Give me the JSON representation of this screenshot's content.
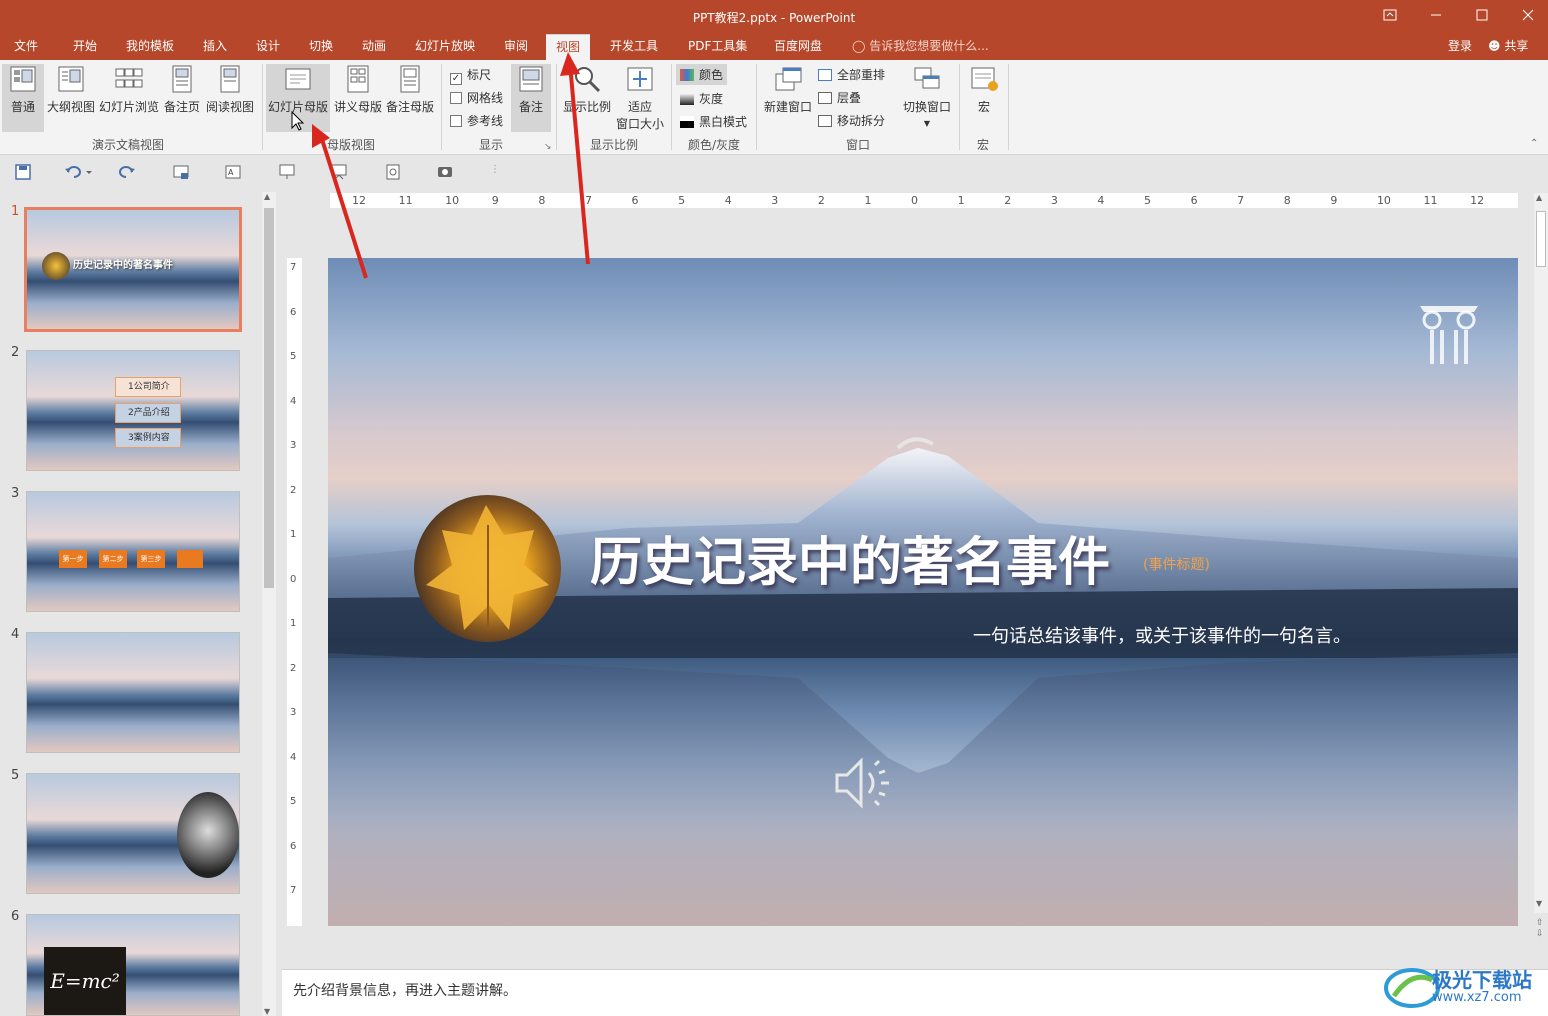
{
  "window": {
    "title": "PPT教程2.pptx - PowerPoint"
  },
  "tabs": [
    "文件",
    "开始",
    "我的模板",
    "插入",
    "设计",
    "切换",
    "动画",
    "幻灯片放映",
    "审阅",
    "视图",
    "开发工具",
    "PDF工具集",
    "百度网盘"
  ],
  "active_tab": "视图",
  "tell_me": "告诉我您想要做什么...",
  "account": {
    "login": "登录",
    "share": "共享"
  },
  "ribbon": {
    "presentation_views": {
      "label": "演示文稿视图",
      "buttons": [
        "普通",
        "大纲视图",
        "幻灯片浏览",
        "备注页",
        "阅读视图"
      ]
    },
    "master_views": {
      "label": "母版视图",
      "buttons": [
        "幻灯片母版",
        "讲义母版",
        "备注母版"
      ]
    },
    "show": {
      "label": "显示",
      "checkboxes": [
        {
          "label": "标尺",
          "checked": true
        },
        {
          "label": "网格线",
          "checked": false
        },
        {
          "label": "参考线",
          "checked": false
        }
      ],
      "notes_button": "备注"
    },
    "zoom": {
      "label": "显示比例",
      "buttons": [
        "显示比例",
        "适应\n窗口大小"
      ],
      "fit_line1": "适应",
      "fit_line2": "窗口大小"
    },
    "color": {
      "label": "颜色/灰度",
      "items": [
        "颜色",
        "灰度",
        "黑白模式"
      ]
    },
    "window": {
      "label": "窗口",
      "new_window": "新建窗口",
      "items": [
        "全部重排",
        "层叠",
        "移动拆分"
      ],
      "switch": "切换窗口"
    },
    "macros": {
      "label": "宏",
      "button": "宏"
    }
  },
  "slides": [
    {
      "num": "1",
      "title": "历史记录中的著名事件"
    },
    {
      "num": "2",
      "items": [
        "1公司简介",
        "2产品介绍",
        "3案例内容"
      ]
    },
    {
      "num": "3",
      "steps": [
        "第一步",
        "第二步",
        "第三步"
      ]
    },
    {
      "num": "4"
    },
    {
      "num": "5"
    },
    {
      "num": "6",
      "formula": "E=mc²"
    }
  ],
  "current_slide": {
    "title": "历史记录中的著名事件",
    "tag": "(事件标题)",
    "subtitle": "一句话总结该事件，或关于该事件的一句名言。"
  },
  "ruler_h": [
    "12",
    "11",
    "10",
    "9",
    "8",
    "7",
    "6",
    "5",
    "4",
    "3",
    "2",
    "1",
    "0",
    "1",
    "2",
    "3",
    "4",
    "5",
    "6",
    "7",
    "8",
    "9",
    "10",
    "11",
    "12"
  ],
  "ruler_v": [
    "7",
    "6",
    "5",
    "4",
    "3",
    "2",
    "1",
    "0",
    "1",
    "2",
    "3",
    "4",
    "5",
    "6",
    "7"
  ],
  "notes": "先介绍背景信息，再进入主题讲解。",
  "watermark": {
    "name": "极光下载站",
    "url": "www.xz7.com"
  }
}
